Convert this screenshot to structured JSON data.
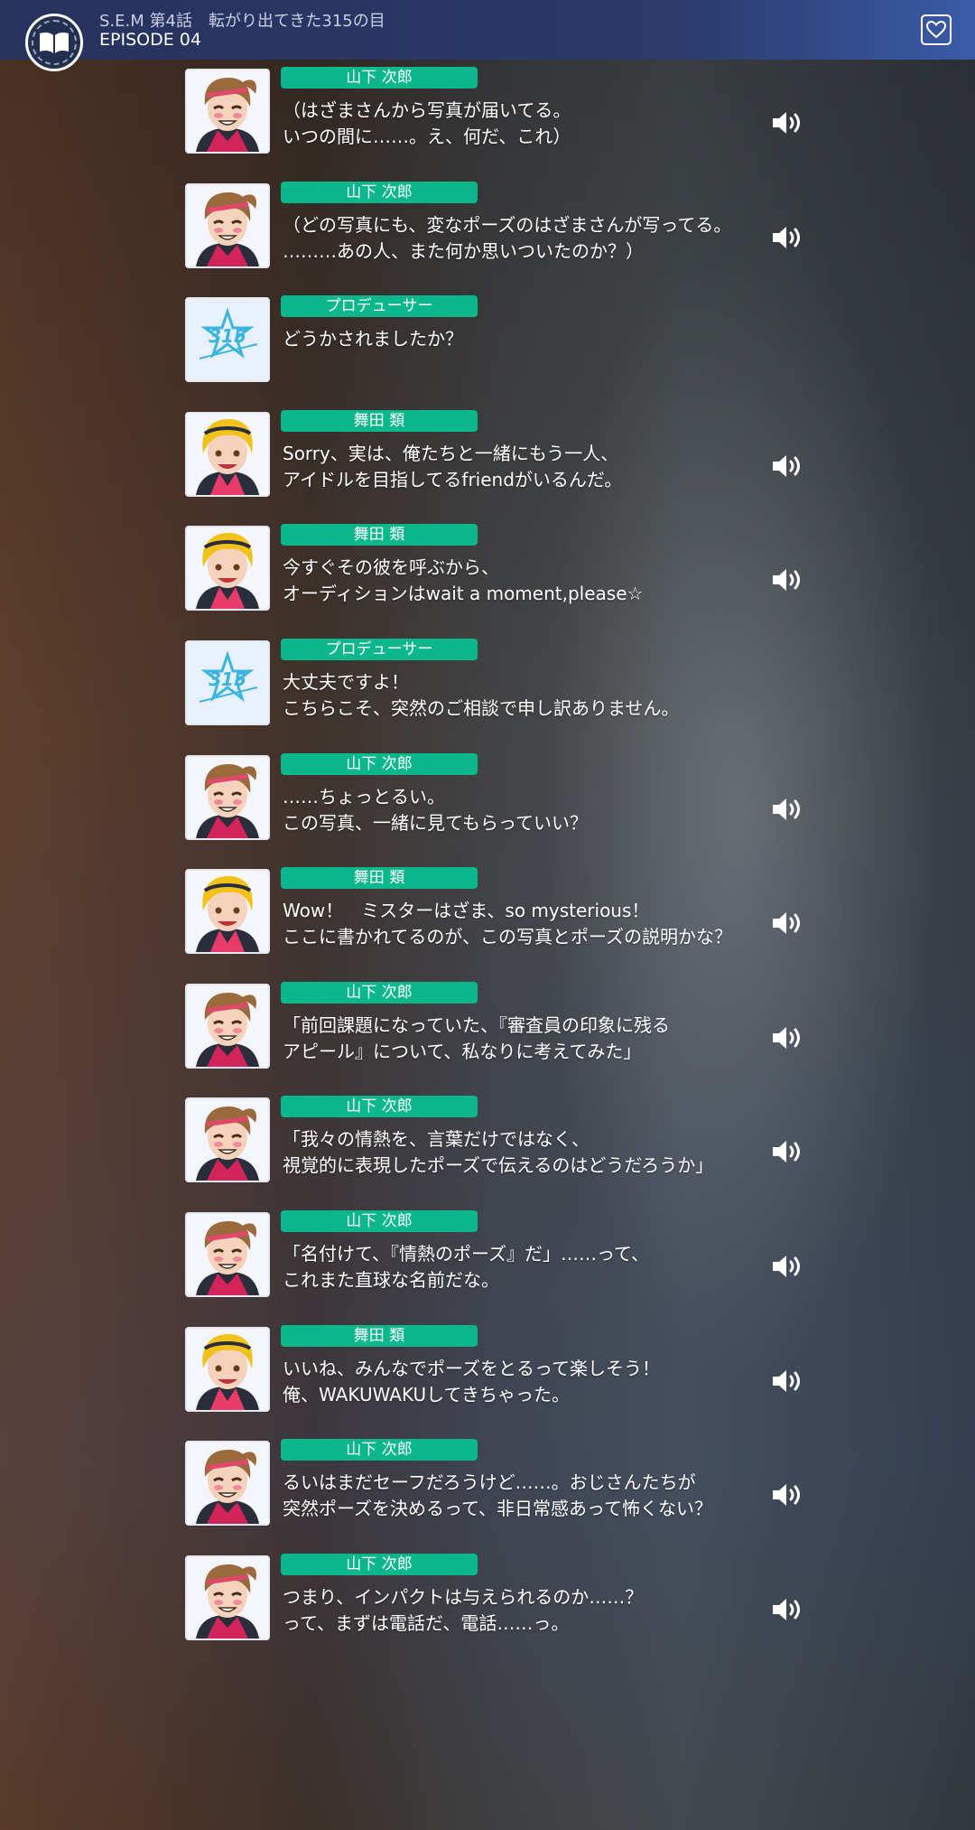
{
  "header": {
    "title": "S.E.M 第4話　転がり出てきた315の目",
    "episode": "EPISODE 04",
    "menu_icon": "book-icon",
    "favorite_icon": "heart-icon"
  },
  "colors": {
    "name_tag": "#0db78c",
    "header_bg": "#2b3a6b"
  },
  "log": [
    {
      "speaker": "山下 次郎",
      "avatar": "jiro-avatar",
      "lines": [
        "（はざまさんから写真が届いてる。",
        "いつの間に……。え、何だ、これ）"
      ],
      "voice": true
    },
    {
      "speaker": "山下 次郎",
      "avatar": "jiro-avatar",
      "lines": [
        "（どの写真にも、変なポーズのはざまさんが写ってる。",
        "………あの人、また何か思いついたのか？）"
      ],
      "voice": true
    },
    {
      "speaker": "プロデューサー",
      "avatar": "315-logo",
      "lines": [
        "どうかされましたか？",
        ""
      ],
      "voice": false
    },
    {
      "speaker": "舞田 類",
      "avatar": "rui-avatar",
      "lines": [
        "Sorry、実は、俺たちと一緒にもう一人、",
        "アイドルを目指してるfriendがいるんだ。"
      ],
      "voice": true
    },
    {
      "speaker": "舞田 類",
      "avatar": "rui-avatar",
      "lines": [
        "今すぐその彼を呼ぶから、",
        "オーディションはwait a moment,please☆"
      ],
      "voice": true
    },
    {
      "speaker": "プロデューサー",
      "avatar": "315-logo",
      "lines": [
        "大丈夫ですよ！",
        "こちらこそ、突然のご相談で申し訳ありません。"
      ],
      "voice": false
    },
    {
      "speaker": "山下 次郎",
      "avatar": "jiro-avatar",
      "lines": [
        "……ちょっとるい。",
        "この写真、一緒に見てもらっていい？"
      ],
      "voice": true
    },
    {
      "speaker": "舞田 類",
      "avatar": "rui-avatar",
      "lines": [
        "Wow！　ミスターはざま、so mysterious！",
        "ここに書かれてるのが、この写真とポーズの説明かな？"
      ],
      "voice": true
    },
    {
      "speaker": "山下 次郎",
      "avatar": "jiro-avatar",
      "lines": [
        "「前回課題になっていた、『審査員の印象に残る",
        "アピール』について、私なりに考えてみた」"
      ],
      "voice": true
    },
    {
      "speaker": "山下 次郎",
      "avatar": "jiro-avatar",
      "lines": [
        "「我々の情熱を、言葉だけではなく、",
        "視覚的に表現したポーズで伝えるのはどうだろうか」"
      ],
      "voice": true
    },
    {
      "speaker": "山下 次郎",
      "avatar": "jiro-avatar",
      "lines": [
        "「名付けて、『情熱のポーズ』だ」……って、",
        "これまた直球な名前だな。"
      ],
      "voice": true
    },
    {
      "speaker": "舞田 類",
      "avatar": "rui-avatar",
      "lines": [
        "いいね、みんなでポーズをとるって楽しそう！",
        "俺、WAKUWAKUしてきちゃった。"
      ],
      "voice": true
    },
    {
      "speaker": "山下 次郎",
      "avatar": "jiro-avatar",
      "lines": [
        "るいはまだセーフだろうけど……。おじさんたちが",
        "突然ポーズを決めるって、非日常感あって怖くない？"
      ],
      "voice": true
    },
    {
      "speaker": "山下 次郎",
      "avatar": "jiro-avatar",
      "lines": [
        "つまり、インパクトは与えられるのか……？",
        "って、まずは電話だ、電話……っ。"
      ],
      "voice": true
    }
  ]
}
